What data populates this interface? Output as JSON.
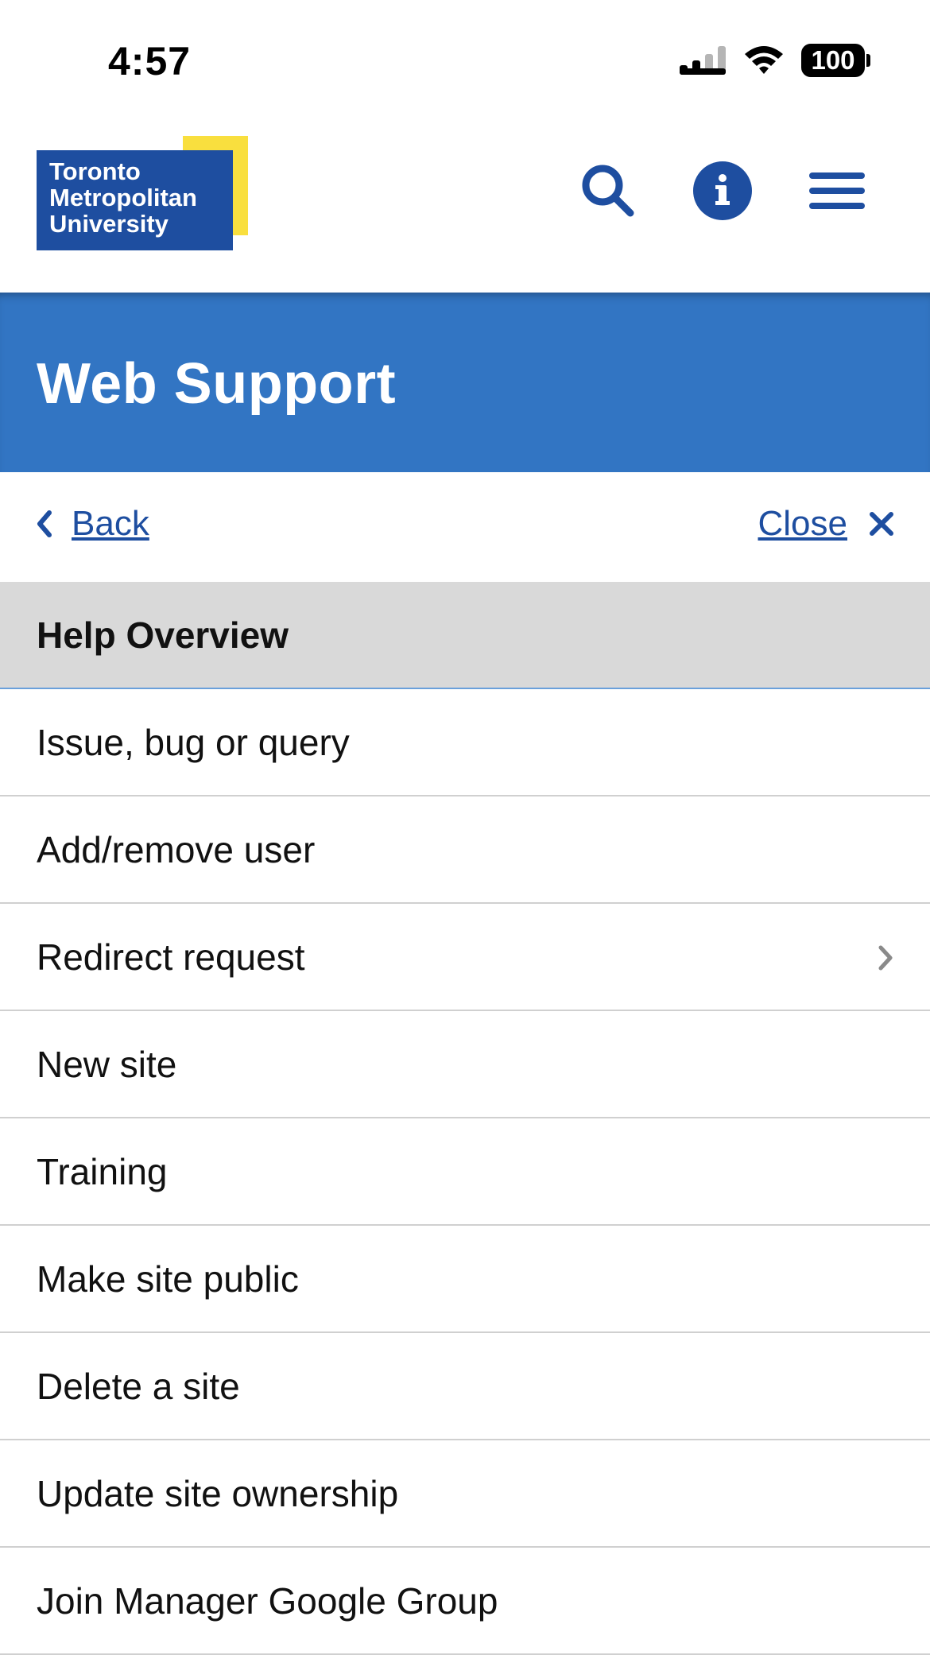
{
  "status_bar": {
    "time": "4:57",
    "battery": "100"
  },
  "header": {
    "logo_lines": [
      "Toronto",
      "Metropolitan",
      "University"
    ],
    "icons": [
      "search-icon",
      "info-icon",
      "hamburger-menu-icon"
    ],
    "colors": {
      "brand_blue": "#1e4ea0",
      "brand_yellow": "#f9df3e"
    }
  },
  "banner": {
    "title": "Web Support",
    "color": "#3275c3"
  },
  "nav": {
    "back_label": "Back",
    "close_label": "Close"
  },
  "menu": {
    "items": [
      {
        "label": "Help Overview",
        "active": true
      },
      {
        "label": "Issue, bug or query"
      },
      {
        "label": "Add/remove user"
      },
      {
        "label": "Redirect request",
        "has_submenu": true
      },
      {
        "label": "New site"
      },
      {
        "label": "Training"
      },
      {
        "label": "Make site public"
      },
      {
        "label": "Delete a site"
      },
      {
        "label": "Update site ownership"
      },
      {
        "label": "Join Manager Google Group"
      }
    ]
  }
}
